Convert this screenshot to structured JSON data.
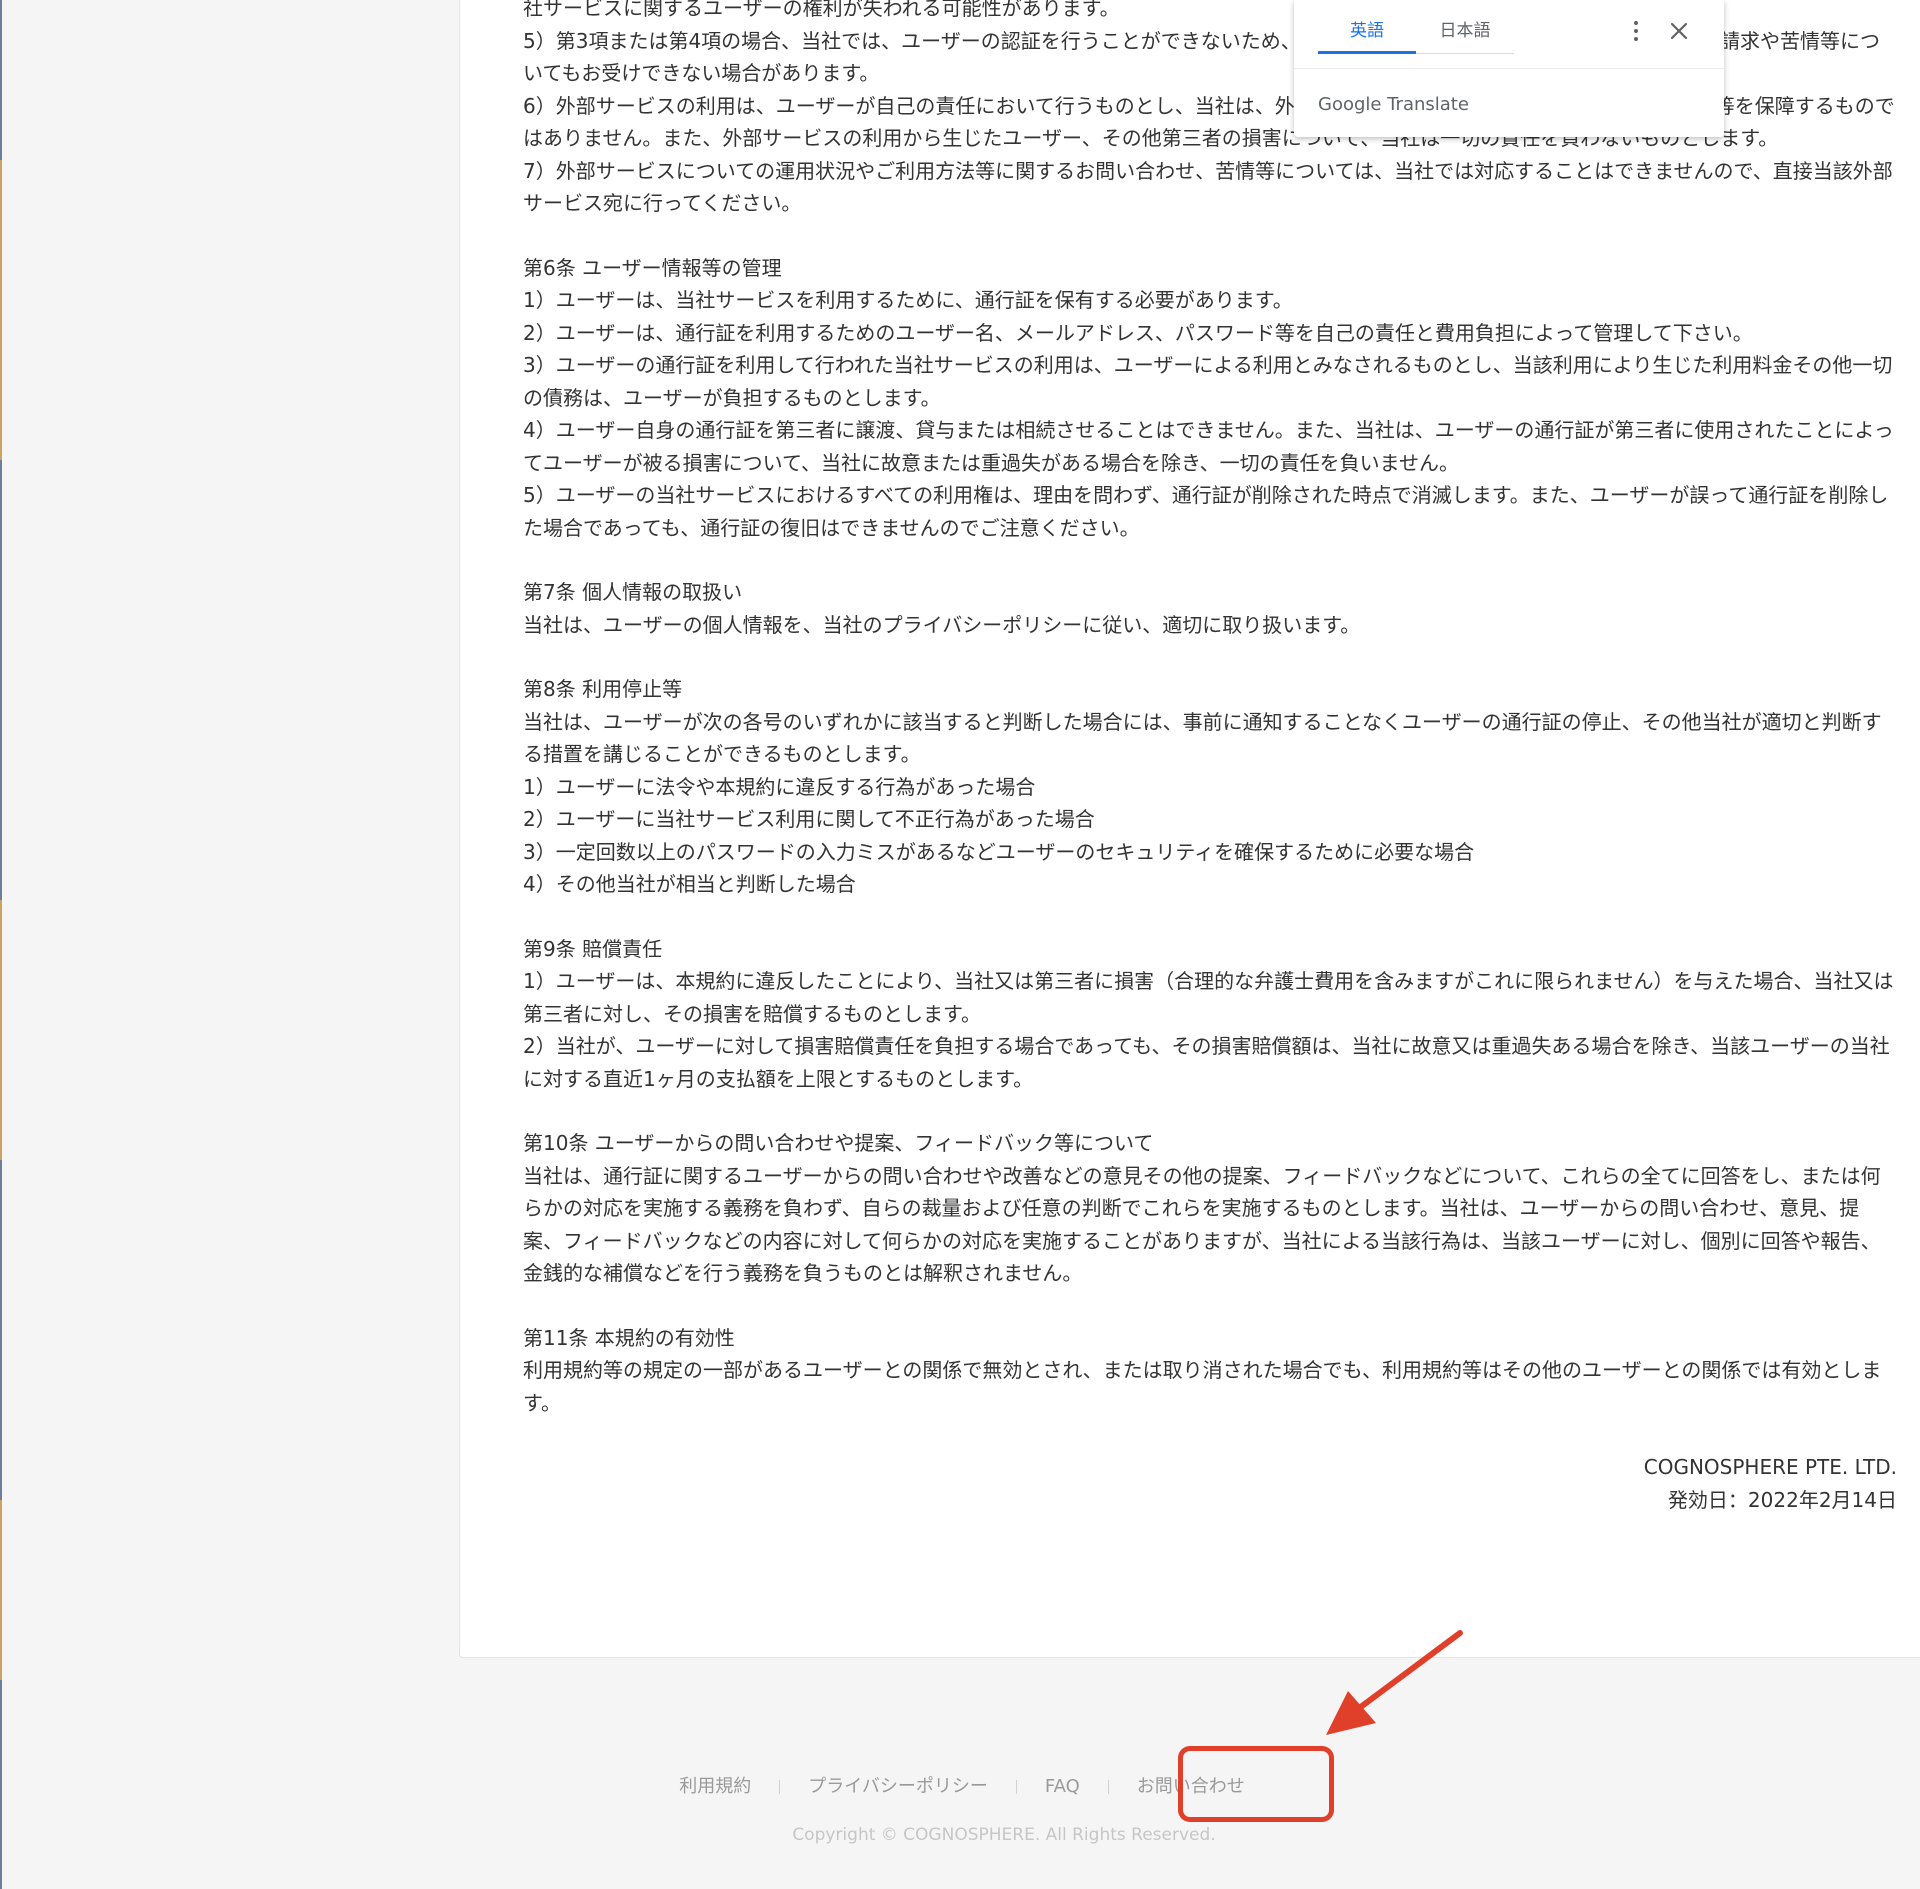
{
  "document": {
    "paragraphs": [
      "社サービスに関するユーザーの権利が失われる可能性があります。",
      "5）第3項または第4項の場合、当社では、ユーザーの認証を行うことができないため、ユーザーの通行証の復旧その他ユーザーからの請求や苦情等についてもお受けできない場合があります。",
      "6）外部サービスの利用は、ユーザーが自己の責任において行うものとし、当社は、外部サービスの正確性、完全性、有用性、安全性等を保障するものではありません。また、外部サービスの利用から生じたユーザー、その他第三者の損害について、当社は一切の責任を負わないものとします。",
      "7）外部サービスについての運用状況やご利用方法等に関するお問い合わせ、苦情等については、当社では対応することはできませんので、直接当該外部サービス宛に行ってください。",
      "",
      "第6条 ユーザー情報等の管理",
      "1）ユーザーは、当社サービスを利用するために、通行証を保有する必要があります。",
      "2）ユーザーは、通行証を利用するためのユーザー名、メールアドレス、パスワード等を自己の責任と費用負担によって管理して下さい。",
      "3）ユーザーの通行証を利用して行われた当社サービスの利用は、ユーザーによる利用とみなされるものとし、当該利用により生じた利用料金その他一切の債務は、ユーザーが負担するものとします。",
      "4）ユーザー自身の通行証を第三者に譲渡、貸与または相続させることはできません。また、当社は、ユーザーの通行証が第三者に使用されたことによってユーザーが被る損害について、当社に故意または重過失がある場合を除き、一切の責任を負いません。",
      "5）ユーザーの当社サービスにおけるすべての利用権は、理由を問わず、通行証が削除された時点で消滅します。また、ユーザーが誤って通行証を削除した場合であっても、通行証の復旧はできませんのでご注意ください。",
      "",
      "第7条 個人情報の取扱い",
      "当社は、ユーザーの個人情報を、当社のプライバシーポリシーに従い、適切に取り扱います。",
      "",
      "第8条 利用停止等",
      "当社は、ユーザーが次の各号のいずれかに該当すると判断した場合には、事前に通知することなくユーザーの通行証の停止、その他当社が適切と判断する措置を講じることができるものとします。",
      "1）ユーザーに法令や本規約に違反する行為があった場合",
      "2）ユーザーに当社サービス利用に関して不正行為があった場合",
      "3）一定回数以上のパスワードの入力ミスがあるなどユーザーのセキュリティを確保するために必要な場合",
      "4）その他当社が相当と判断した場合",
      "",
      "第9条 賠償責任",
      "1）ユーザーは、本規約に違反したことにより、当社又は第三者に損害（合理的な弁護士費用を含みますがこれに限られません）を与えた場合、当社又は第三者に対し、その損害を賠償するものとします。",
      "2）当社が、ユーザーに対して損害賠償責任を負担する場合であっても、その損害賠償額は、当社に故意又は重過失ある場合を除き、当該ユーザーの当社に対する直近1ヶ月の支払額を上限とするものとします。",
      "",
      "第10条 ユーザーからの問い合わせや提案、フィードバック等について",
      "当社は、通行証に関するユーザーからの問い合わせや改善などの意見その他の提案、フィードバックなどについて、これらの全てに回答をし、または何らかの対応を実施する義務を負わず、自らの裁量および任意の判断でこれらを実施するものとします。当社は、ユーザーからの問い合わせ、意見、提案、フィードバックなどの内容に対して何らかの対応を実施することがありますが、当社による当該行為は、当該ユーザーに対し、個別に回答や報告、金銭的な補償などを行う義務を負うものとは解釈されません。",
      "",
      "第11条 本規約の有効性",
      "利用規約等の規定の一部があるユーザーとの関係で無効とされ、または取り消された場合でも、利用規約等はその他のユーザーとの関係では有効とします。",
      ""
    ],
    "company": "COGNOSPHERE PTE. LTD.",
    "effective_date": "発効日：2022年2月14日"
  },
  "translate_popup": {
    "tab_source": "英語",
    "tab_target": "日本語",
    "brand": "Google Translate",
    "more_icon": "more-vert-icon",
    "close_icon": "close-icon"
  },
  "footer": {
    "links": [
      "利用規約",
      "プライバシーポリシー",
      "FAQ",
      "お問い合わせ"
    ],
    "copyright": "Copyright © COGNOSPHERE. All Rights Reserved."
  },
  "annotation": {
    "color": "#e0402a"
  }
}
